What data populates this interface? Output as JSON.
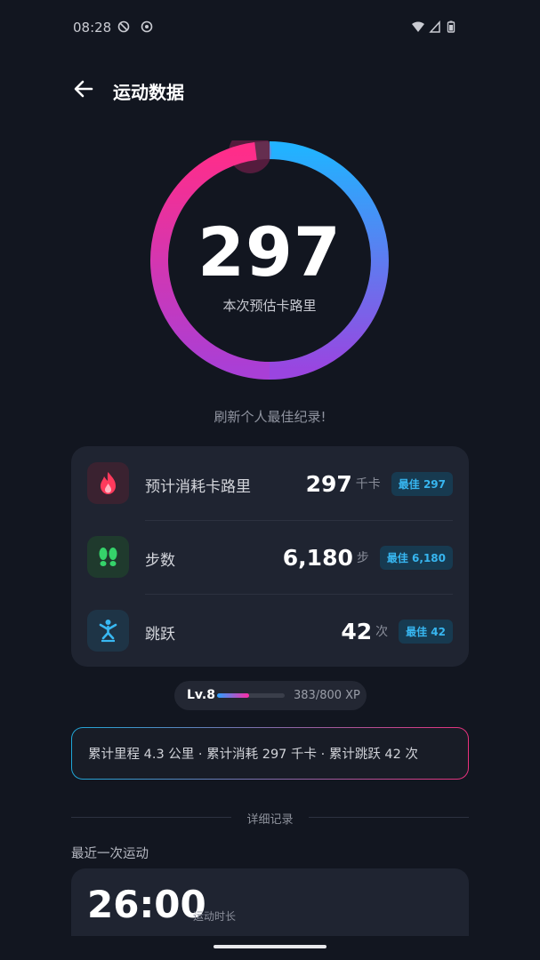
{
  "status_bar": {
    "time": "08:28"
  },
  "header": {
    "title": "运动数据"
  },
  "ring": {
    "value": "297",
    "label": "本次预估卡路里",
    "progress": 0.98,
    "colors": [
      "#ff2d8a",
      "#b040d8",
      "#2ab0ff"
    ]
  },
  "record_text": "刷新个人最佳纪录!",
  "stats": [
    {
      "label": "预计消耗卡路里",
      "value": "297",
      "unit": "千卡",
      "best": "最佳 297",
      "icon": "flame-icon",
      "icon_bg": "#3a2230",
      "icon_color": "#ff3a5c"
    },
    {
      "label": "步数",
      "value": "6,180",
      "unit": "步",
      "best": "最佳 6,180",
      "icon": "footsteps-icon",
      "icon_bg": "#1f3a2d",
      "icon_color": "#35d36a"
    },
    {
      "label": "跳跃",
      "value": "42",
      "unit": "次",
      "best": "最佳 42",
      "icon": "jump-icon",
      "icon_bg": "#1e3446",
      "icon_color": "#38b8f2"
    }
  ],
  "level": {
    "label": "Lv.8",
    "xp_text": "383/800 XP",
    "progress": 0.479
  },
  "summary": "累计里程 4.3 公里 · 累计消耗 297 千卡 · 累计跳跃 42 次",
  "section_title": "详细记录",
  "recent": {
    "title": "最近一次运动",
    "duration": "26:00",
    "duration_label": "运动时长"
  }
}
